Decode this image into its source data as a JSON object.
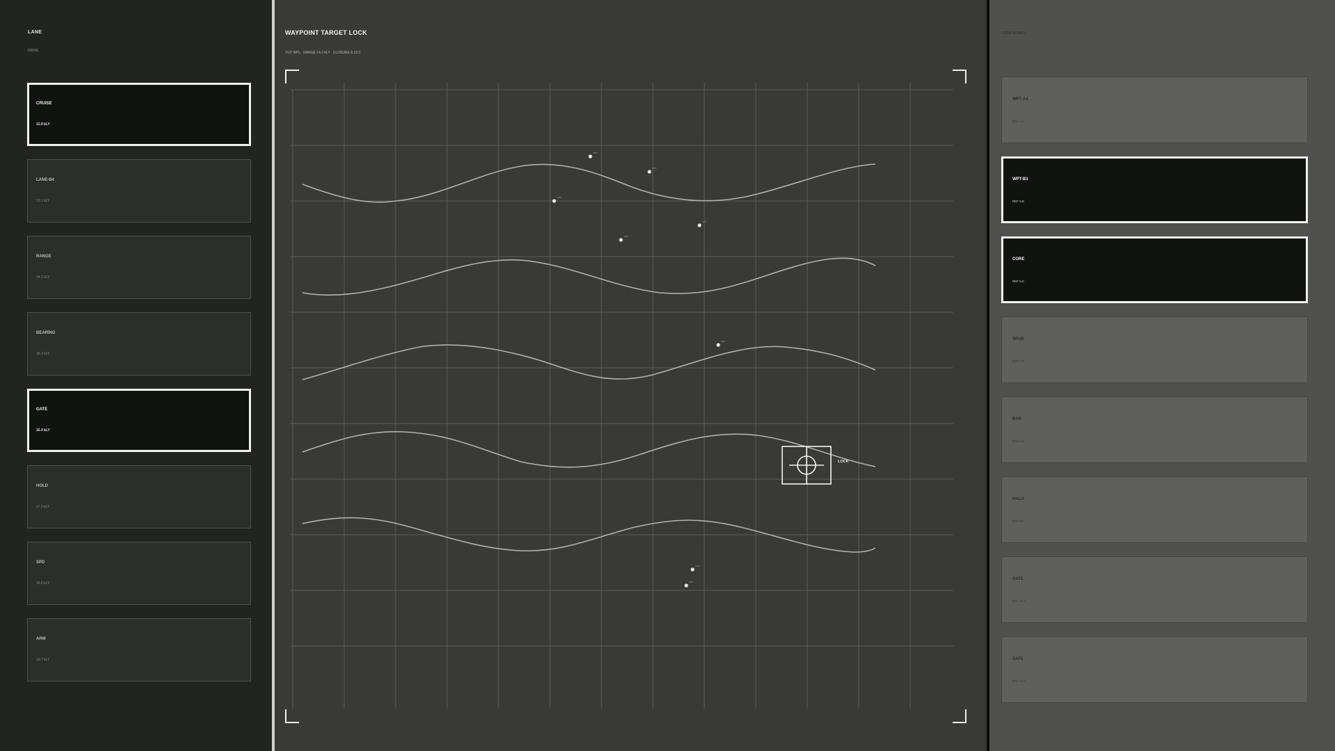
{
  "lane_panel": {
    "title": "LANE",
    "subtitle": "DRIVE",
    "items": [
      {
        "name": "CRUISE",
        "value": "12.8 kLY",
        "active": true
      },
      {
        "name": "LANE-B4",
        "value": "13.1 kLY",
        "active": false
      },
      {
        "name": "RANGE",
        "value": "14.2 kLY",
        "active": false
      },
      {
        "name": "BEARING",
        "value": "15.3 kLY",
        "active": false
      },
      {
        "name": "GATE",
        "value": "16.4 kLY",
        "active": true
      },
      {
        "name": "HOLD",
        "value": "17.5 kLY",
        "active": false
      },
      {
        "name": "SPD",
        "value": "18.6 kLY",
        "active": false
      },
      {
        "name": "ARM",
        "value": "19.7 kLY",
        "active": false
      }
    ]
  },
  "target_panel": {
    "title": "WAYPOINT TARGET LOCK",
    "stats": "TGT WPL   RANGE 14.2 kLY   CLOSURE 8.13 C",
    "reticle_label": "LOCK",
    "waypoints": [
      {
        "label": "WPT"
      },
      {
        "label": "WPT"
      },
      {
        "label": "WPT"
      },
      {
        "label": "WPT"
      },
      {
        "label": "WPT"
      },
      {
        "label": "WPT"
      },
      {
        "label": "WPT"
      },
      {
        "label": "WPT"
      }
    ]
  },
  "lock_board": {
    "title": "LOCK BOARD",
    "items": [
      {
        "name": "WPT-A4",
        "ref": "REF 4.A",
        "active": false
      },
      {
        "name": "WPT-B1",
        "ref": "REF 5.B",
        "active": true
      },
      {
        "name": "CORE",
        "ref": "REF 6.C",
        "active": true
      },
      {
        "name": "SPUR",
        "ref": "REF 7.D",
        "active": false
      },
      {
        "name": "BAR",
        "ref": "REF 8.E",
        "active": false
      },
      {
        "name": "HALO",
        "ref": "REF 9.F",
        "active": false
      },
      {
        "name": "GATE",
        "ref": "REF 10.G",
        "active": false
      },
      {
        "name": "SAFE",
        "ref": "REF 11.H",
        "active": false
      }
    ]
  }
}
